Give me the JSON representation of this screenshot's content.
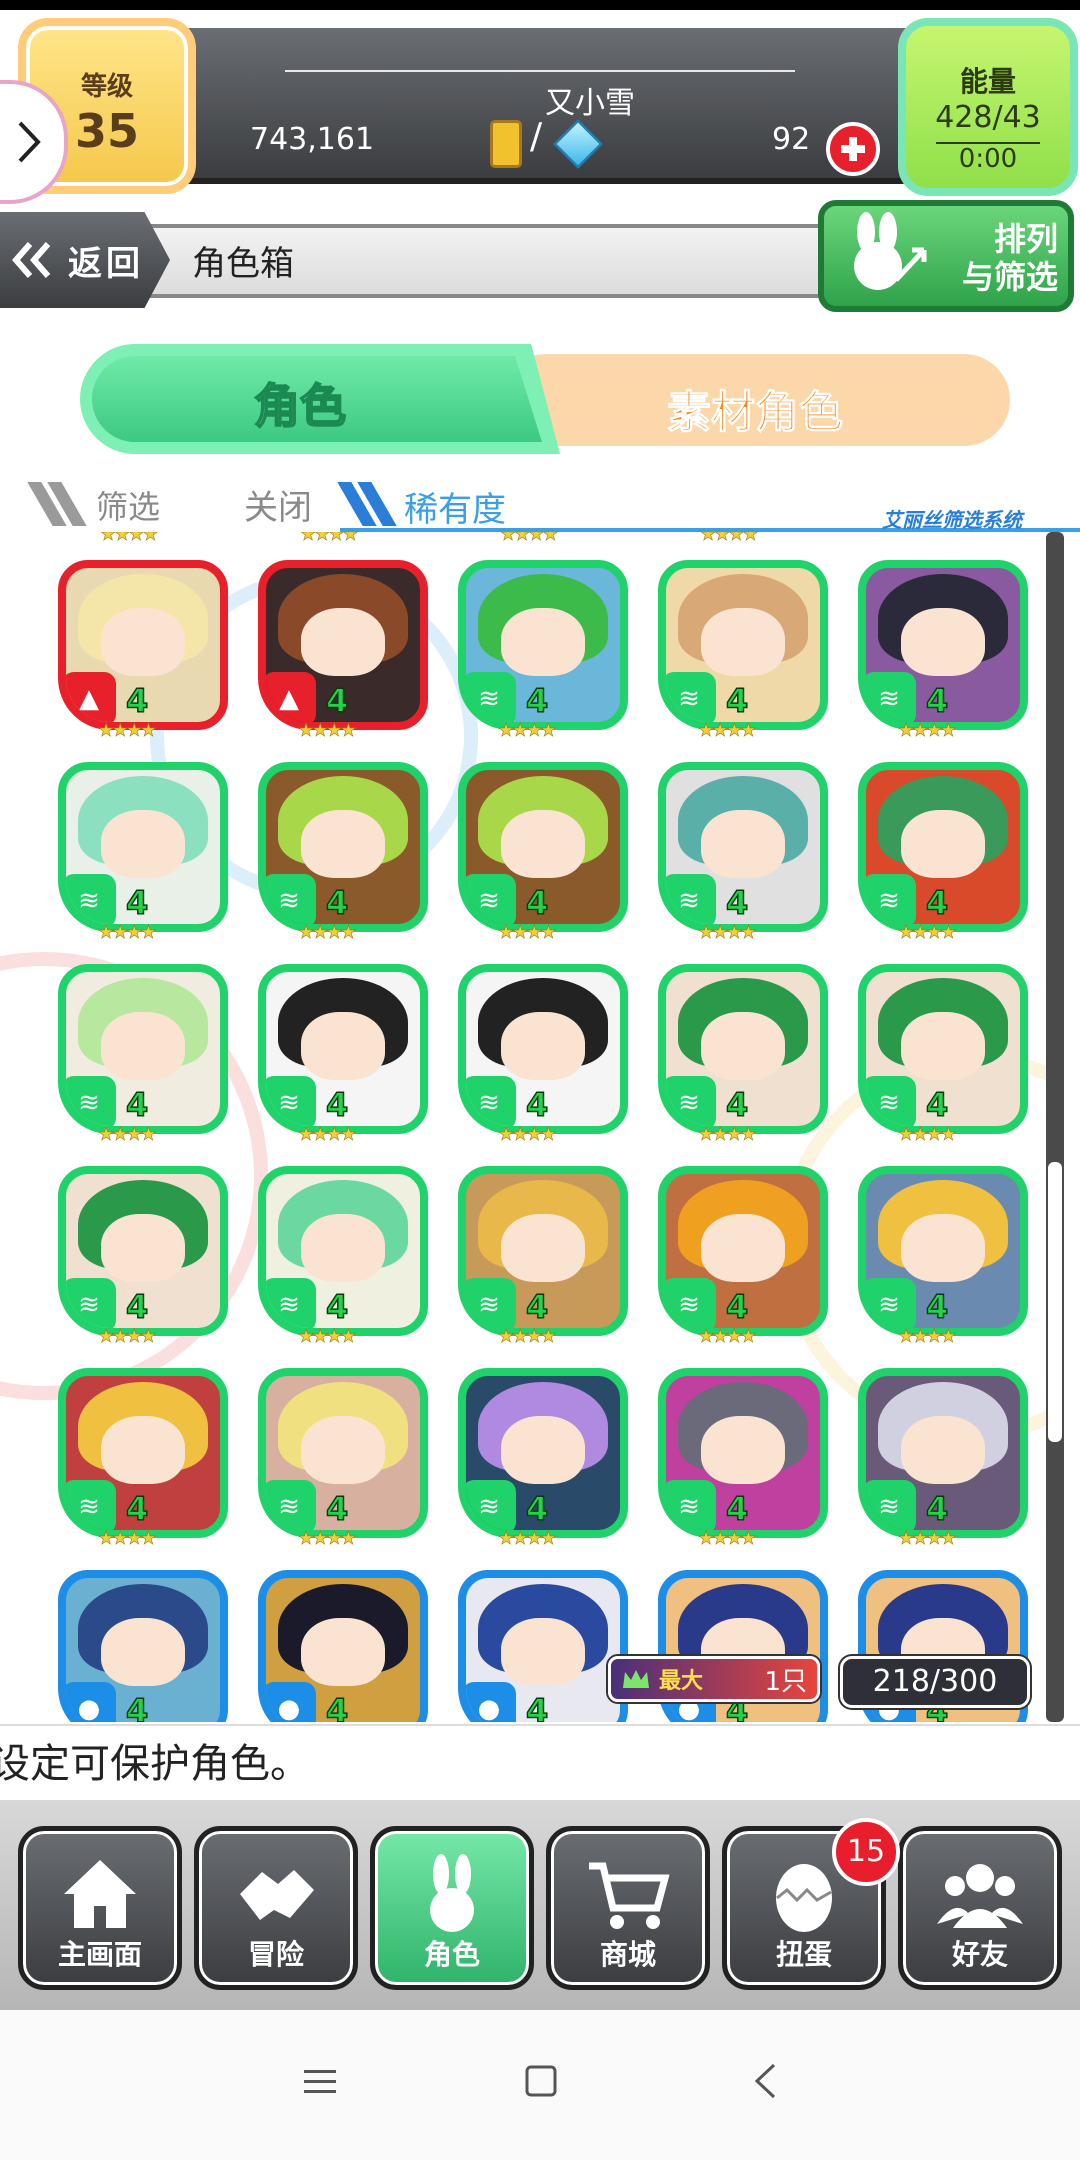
{
  "header": {
    "level_label": "等级",
    "level_value": "35",
    "player_name": "又小雪",
    "money": "743,161",
    "slash": "/",
    "gem_count": "92",
    "energy_label": "能量",
    "energy_value": "428/43",
    "energy_timer": "0:00"
  },
  "nav_row": {
    "back_label": "返回",
    "page_title": "角色箱",
    "sort_line1": "排列",
    "sort_line2": "与筛选"
  },
  "tabs": {
    "characters": "角色",
    "materials": "素材角色"
  },
  "filter": {
    "label": "筛选",
    "state": "关闭",
    "rarity": "稀有度",
    "system": "艾丽丝筛选系统"
  },
  "cards": [
    {
      "frame": "red",
      "attr": "fire",
      "level": "4",
      "stars": "★★★★",
      "hair": "#f3e6a8",
      "bg": "#e9d9b0"
    },
    {
      "frame": "red",
      "attr": "fire",
      "level": "4",
      "stars": "★★★★",
      "hair": "#8a4a2a",
      "bg": "#3a2a2a"
    },
    {
      "frame": "green",
      "attr": "wind",
      "level": "4",
      "stars": "★★★★",
      "hair": "#3dbb4a",
      "bg": "#6ab7d9"
    },
    {
      "frame": "green",
      "attr": "wind",
      "level": "4",
      "stars": "★★★★",
      "hair": "#d9a877",
      "bg": "#f0d9a8"
    },
    {
      "frame": "green",
      "attr": "wind",
      "level": "4",
      "stars": "★★★★",
      "hair": "#2a2a3a",
      "bg": "#8a5aa0"
    },
    {
      "frame": "green",
      "attr": "wind",
      "level": "4",
      "stars": "★★★★",
      "hair": "#8be0c0",
      "bg": "#e8f0e8"
    },
    {
      "frame": "green",
      "attr": "wind",
      "level": "4",
      "stars": "★★★★",
      "hair": "#a8d84a",
      "bg": "#8a5a2a"
    },
    {
      "frame": "green",
      "attr": "wind",
      "level": "4",
      "stars": "★★★★",
      "hair": "#a8d84a",
      "bg": "#8a5a2a"
    },
    {
      "frame": "green",
      "attr": "wind",
      "level": "4",
      "stars": "★★★★",
      "hair": "#5ab0a8",
      "bg": "#e0e0e0"
    },
    {
      "frame": "green",
      "attr": "wind",
      "level": "4",
      "stars": "★★★★",
      "hair": "#3a9a5a",
      "bg": "#d84a2a"
    },
    {
      "frame": "green",
      "attr": "wind",
      "level": "4",
      "stars": "★★★★",
      "hair": "#b8e8a0",
      "bg": "#f0ece0"
    },
    {
      "frame": "green",
      "attr": "wind",
      "level": "4",
      "stars": "★★★★",
      "hair": "#222222",
      "bg": "#f5f5f5"
    },
    {
      "frame": "green",
      "attr": "wind",
      "level": "4",
      "stars": "★★★★",
      "hair": "#222222",
      "bg": "#f5f5f5"
    },
    {
      "frame": "green",
      "attr": "wind",
      "level": "4",
      "stars": "★★★★",
      "hair": "#2a9a4a",
      "bg": "#f0e0d0"
    },
    {
      "frame": "green",
      "attr": "wind",
      "level": "4",
      "stars": "★★★★",
      "hair": "#2a9a4a",
      "bg": "#f0e0d0"
    },
    {
      "frame": "green",
      "attr": "wind",
      "level": "4",
      "stars": "★★★★",
      "hair": "#2a9a4a",
      "bg": "#f0e0d0"
    },
    {
      "frame": "green",
      "attr": "wind",
      "level": "4",
      "stars": "★★★★",
      "hair": "#6ad8a0",
      "bg": "#f0f0e0"
    },
    {
      "frame": "green",
      "attr": "wind",
      "level": "4",
      "stars": "★★★★",
      "hair": "#e8b84a",
      "bg": "#c89a5a"
    },
    {
      "frame": "green",
      "attr": "wind",
      "level": "4",
      "stars": "★★★★",
      "hair": "#f0a020",
      "bg": "#c07040"
    },
    {
      "frame": "green",
      "attr": "wind",
      "level": "4",
      "stars": "★★★★",
      "hair": "#f0c040",
      "bg": "#6a8ab0"
    },
    {
      "frame": "green",
      "attr": "wind",
      "level": "4",
      "stars": "★★★★",
      "hair": "#f0c040",
      "bg": "#c04040"
    },
    {
      "frame": "green",
      "attr": "wind",
      "level": "4",
      "stars": "★★★★",
      "hair": "#f0e080",
      "bg": "#d8b0a0"
    },
    {
      "frame": "green",
      "attr": "wind",
      "level": "4",
      "stars": "★★★★",
      "hair": "#b08ae0",
      "bg": "#2a4a6a"
    },
    {
      "frame": "green",
      "attr": "wind",
      "level": "4",
      "stars": "★★★★",
      "hair": "#6a6a7a",
      "bg": "#c040a0"
    },
    {
      "frame": "green",
      "attr": "wind",
      "level": "4",
      "stars": "★★★★",
      "hair": "#d0d0e0",
      "bg": "#6a5a7a"
    },
    {
      "frame": "blue",
      "attr": "water",
      "level": "4",
      "stars": "★★★★",
      "hair": "#2a4a8a",
      "bg": "#6ab0d0"
    },
    {
      "frame": "blue",
      "attr": "water",
      "level": "4",
      "stars": "★★★★",
      "hair": "#1a1a2a",
      "bg": "#d0a040"
    },
    {
      "frame": "blue",
      "attr": "water",
      "level": "4",
      "stars": "★★★★",
      "hair": "#2a4aa0",
      "bg": "#e8e8f0"
    },
    {
      "frame": "blue",
      "attr": "water",
      "level": "4",
      "stars": "★★★★",
      "hair": "#2a3a8a",
      "bg": "#f0c080"
    },
    {
      "frame": "blue",
      "attr": "water",
      "level": "4",
      "stars": "★★★★",
      "hair": "#2a3a8a",
      "bg": "#f0c080"
    }
  ],
  "grid_footer": {
    "max_label": "最大",
    "max_value": "1只",
    "count": "218/300"
  },
  "message": "设定可保护角色。",
  "bottom_nav": [
    {
      "label": "主画面",
      "icon": "home-icon"
    },
    {
      "label": "冒险",
      "icon": "handshake-icon"
    },
    {
      "label": "角色",
      "icon": "rabbit-icon"
    },
    {
      "label": "商城",
      "icon": "cart-icon"
    },
    {
      "label": "扭蛋",
      "icon": "egg-icon"
    },
    {
      "label": "好友",
      "icon": "friends-icon"
    }
  ],
  "gacha_badge": "15",
  "colors": {
    "frame_red": "#e8202b",
    "frame_green": "#1fd36a",
    "frame_blue": "#1c8ee8",
    "accent_blue": "#3aa0e6"
  }
}
